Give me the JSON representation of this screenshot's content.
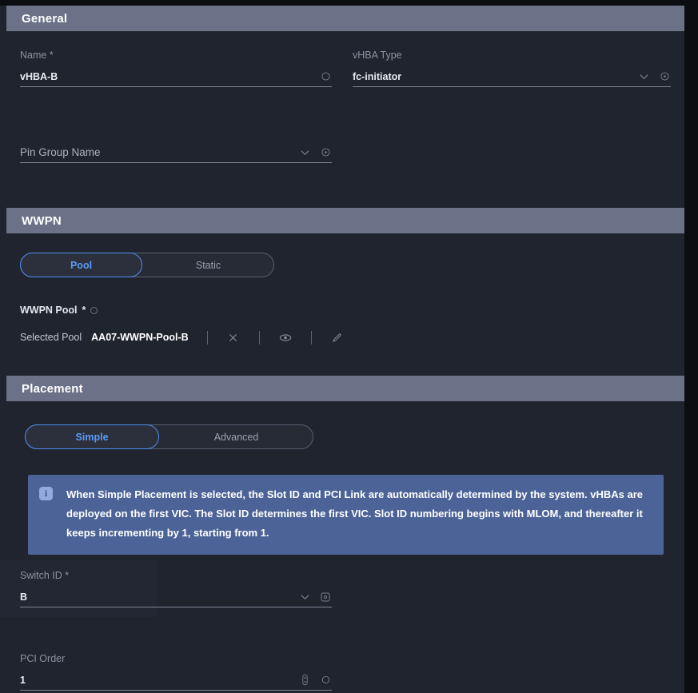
{
  "sections": {
    "general": {
      "title": "General",
      "name_field": {
        "label": "Name",
        "required": "*",
        "value": "vHBA-B",
        "info_icon": "info-circle-icon"
      },
      "vhba_type_field": {
        "label": "vHBA Type",
        "value": "fc-initiator",
        "chevron_icon": "chevron-down-icon",
        "info_icon": "info-circle-icon"
      },
      "pin_group_field": {
        "label": "",
        "placeholder": "Pin Group Name",
        "value": "Pin Group Name",
        "chevron_icon": "chevron-down-icon",
        "info_icon": "info-circle-icon"
      }
    },
    "wwpn": {
      "title": "WWPN",
      "toggle": {
        "options": [
          "Pool",
          "Static"
        ],
        "selected": "Pool"
      },
      "pool_label": "WWPN Pool",
      "pool_required": "*",
      "selected_pool_label": "Selected Pool",
      "selected_pool_value": "AA07-WWPN-Pool-B",
      "actions": [
        {
          "name": "close-icon",
          "glyph": "×"
        },
        {
          "name": "eye-icon",
          "glyph": ""
        },
        {
          "name": "pencil-icon",
          "glyph": ""
        }
      ]
    },
    "placement": {
      "title": "Placement",
      "toggle": {
        "options": [
          "Simple",
          "Advanced"
        ],
        "selected": "Simple"
      },
      "info_banner": {
        "icon": "info-icon",
        "text": "When Simple Placement is selected, the Slot ID and PCI Link are automatically determined by the system. vHBAs are deployed on the first VIC. The Slot ID determines the first VIC. Slot ID numbering begins with MLOM, and thereafter it keeps incrementing by 1, starting from 1."
      },
      "switch_id_field": {
        "label": "Switch ID",
        "required": "*",
        "value": "B",
        "chevron_icon": "chevron-down-icon",
        "info_icon": "info-circle-icon"
      },
      "pci_order_field": {
        "label": "PCI Order",
        "value": "1",
        "stepper_icon": "stepper-icon",
        "info_icon": "info-circle-icon"
      }
    }
  },
  "colors": {
    "section_bar": "#6b7287",
    "accent_blue": "#5b9bf8",
    "banner_blue": "#4c6398",
    "panel_bg": "#20242e"
  }
}
